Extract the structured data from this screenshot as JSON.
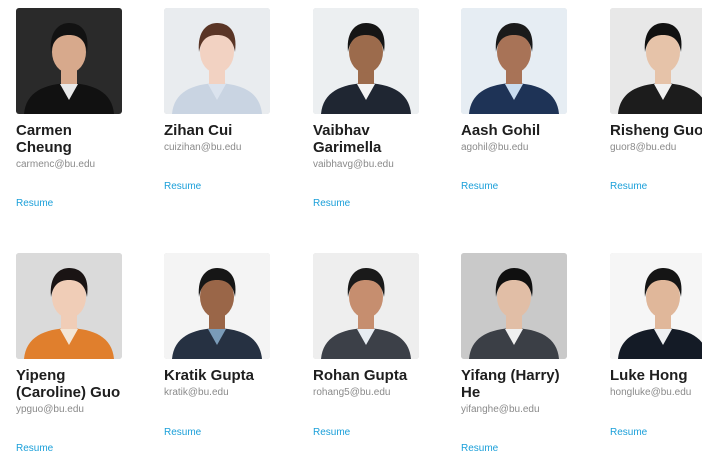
{
  "people": [
    {
      "name": "Carmen Cheung",
      "email": "carmenc@bu.edu",
      "resume": "Resume",
      "colors": {
        "bg": "#2a2a2a",
        "skin": "#d7a98c",
        "hair": "#121212",
        "shirt": "#111111",
        "collar": "#e9e9e9"
      }
    },
    {
      "name": "Zihan Cui",
      "email": "cuizihan@bu.edu",
      "resume": "Resume",
      "colors": {
        "bg": "#e9ecef",
        "skin": "#f2d2c2",
        "hair": "#5a3526",
        "shirt": "#c9d4e2",
        "collar": "#dbe3ee"
      }
    },
    {
      "name": "Vaibhav Garimella",
      "email": "vaibhavg@bu.edu",
      "resume": "Resume",
      "colors": {
        "bg": "#eceff1",
        "skin": "#9c6b4c",
        "hair": "#151515",
        "shirt": "#1f2632",
        "collar": "#f3f3f3"
      }
    },
    {
      "name": "Aash Gohil",
      "email": "agohil@bu.edu",
      "resume": "Resume",
      "colors": {
        "bg": "#e6edf3",
        "skin": "#a87357",
        "hair": "#1a1a1a",
        "shirt": "#1e3356",
        "collar": "#c9dcef"
      }
    },
    {
      "name": "Risheng Guo",
      "email": "guor8@bu.edu",
      "resume": "Resume",
      "colors": {
        "bg": "#e8e8e8",
        "skin": "#e6c3a9",
        "hair": "#111111",
        "shirt": "#1c1c1c",
        "collar": "#f1f1f1"
      }
    },
    {
      "name": "Yipeng (Caroline) Guo",
      "email": "ypguo@bu.edu",
      "resume": "Resume",
      "colors": {
        "bg": "#dadada",
        "skin": "#f0cdb7",
        "hair": "#1a1414",
        "shirt": "#e07f2d",
        "collar": "#f3e6d6"
      }
    },
    {
      "name": "Kratik Gupta",
      "email": "kratik@bu.edu",
      "resume": "Resume",
      "colors": {
        "bg": "#f4f4f4",
        "skin": "#9a6648",
        "hair": "#161616",
        "shirt": "#263142",
        "collar": "#7a9bb8"
      }
    },
    {
      "name": "Rohan Gupta",
      "email": "rohang5@bu.edu",
      "resume": "Resume",
      "colors": {
        "bg": "#eeeeee",
        "skin": "#c68e6f",
        "hair": "#1a1a1a",
        "shirt": "#3c4048",
        "collar": "#e7ecf2"
      }
    },
    {
      "name": "Yifang (Harry) He",
      "email": "yifanghe@bu.edu",
      "resume": "Resume",
      "colors": {
        "bg": "#c9c9c9",
        "skin": "#e1bea6",
        "hair": "#101010",
        "shirt": "#3b3f46",
        "collar": "#f0f0f0"
      }
    },
    {
      "name": "Luke Hong",
      "email": "hongluke@bu.edu",
      "resume": "Resume",
      "colors": {
        "bg": "#f6f6f6",
        "skin": "#e0b79a",
        "hair": "#151515",
        "shirt": "#141b26",
        "collar": "#eef0f2"
      }
    }
  ]
}
